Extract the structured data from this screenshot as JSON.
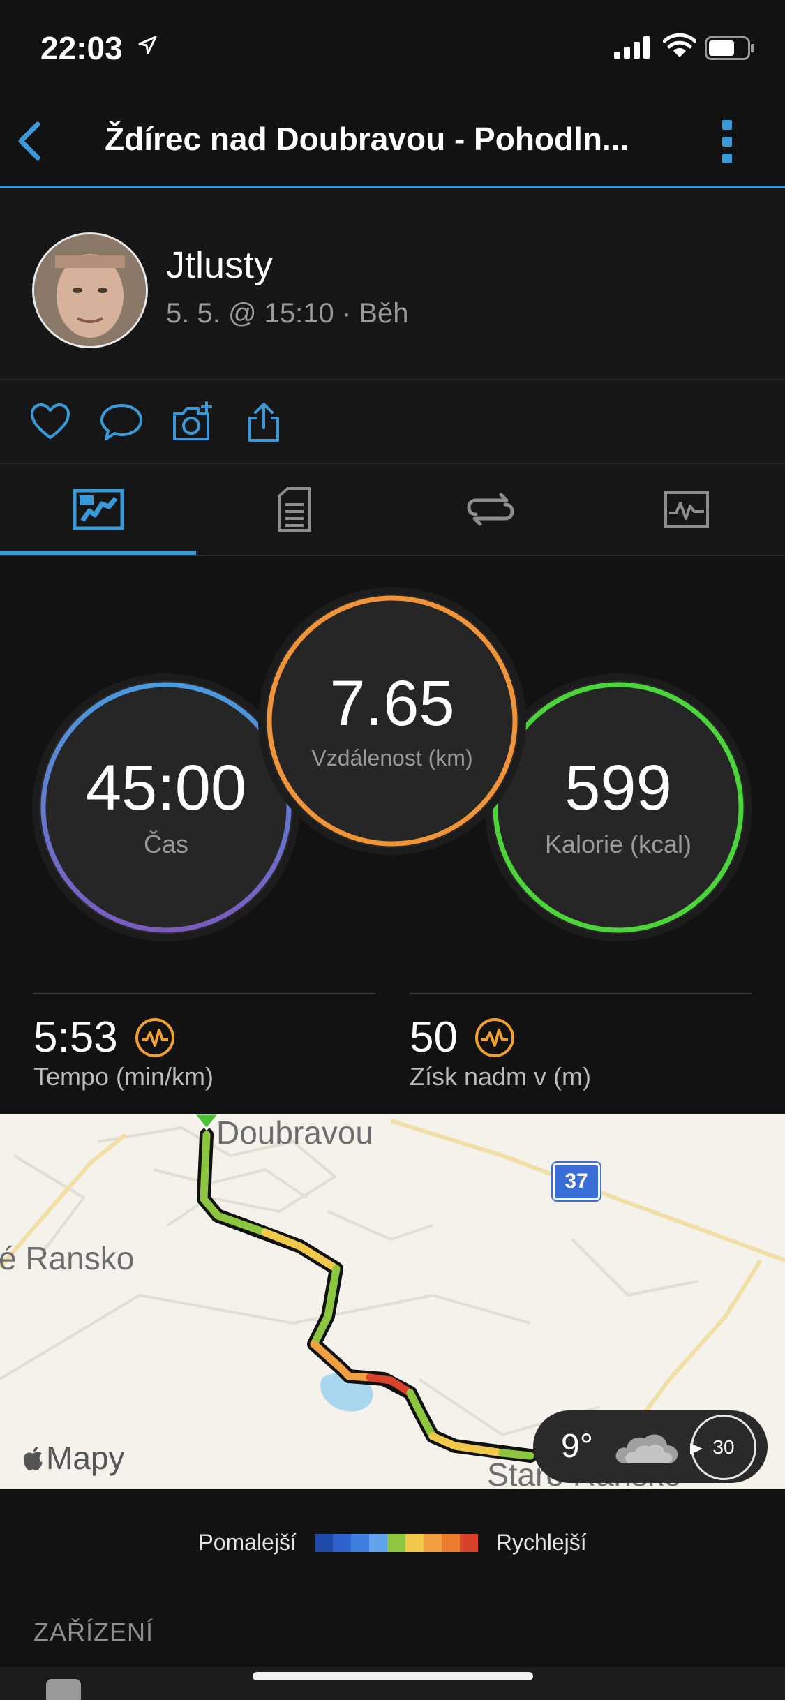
{
  "status_bar": {
    "time": "22:03"
  },
  "header": {
    "title": "Ždírec nad Doubravou - Pohodln..."
  },
  "profile": {
    "username": "Jtlusty",
    "meta": "5. 5. @ 15:10 · Běh"
  },
  "stats": {
    "time": {
      "value": "45:00",
      "label": "Čas"
    },
    "distance": {
      "value": "7.65",
      "label": "Vzdálenost (km)"
    },
    "calories": {
      "value": "599",
      "label": "Kalorie (kcal)"
    },
    "pace": {
      "value": "5:53",
      "label": "Tempo (min/km)"
    },
    "elevation": {
      "value": "50",
      "label": "Získ nadm v (m)"
    }
  },
  "map": {
    "label_town": "Doubravou",
    "label_west": "é Ransko",
    "label_south": "Staré Ransko",
    "road_number": "37",
    "attribution": "Mapy",
    "weather": {
      "temperature": "9°",
      "wind": "30"
    }
  },
  "legend": {
    "slower": "Pomalejší",
    "faster": "Rychlejší",
    "colors": [
      "#1f4aa8",
      "#2e62cc",
      "#3f7fe0",
      "#63a2ec",
      "#8cc63f",
      "#f0c94a",
      "#f0a040",
      "#e87b2e",
      "#d9432b"
    ]
  },
  "section": {
    "title": "ZAŘÍZENÍ"
  },
  "colors": {
    "accent": "#3a9ad9",
    "distance_ring": "#f0943a",
    "calorie_ring": "#4bd53a",
    "time_ring_top": "#4a9ade",
    "time_ring_bottom": "#7b5bbf"
  }
}
